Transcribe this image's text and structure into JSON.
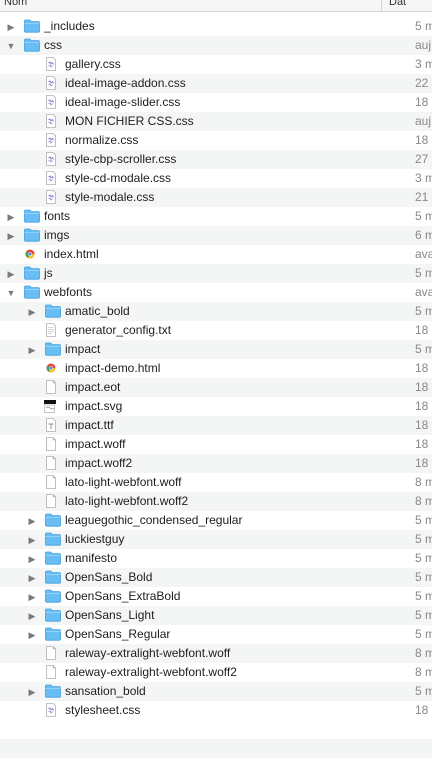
{
  "header": {
    "name_col": "Nom",
    "date_col": "Dat"
  },
  "colors": {
    "folder": "#5fb8f2",
    "stripe": "#f4f5f5"
  },
  "rows": [
    {
      "name": "_includes",
      "date": "5 m",
      "kind": "folder",
      "depth": 0,
      "disc": "collapsed"
    },
    {
      "name": "css",
      "date": "auj",
      "kind": "folder",
      "depth": 0,
      "disc": "expanded"
    },
    {
      "name": "gallery.css",
      "date": "3 m",
      "kind": "css",
      "depth": 1
    },
    {
      "name": "ideal-image-addon.css",
      "date": "22",
      "kind": "css",
      "depth": 1
    },
    {
      "name": "ideal-image-slider.css",
      "date": "18",
      "kind": "css",
      "depth": 1
    },
    {
      "name": "MON FICHIER CSS.css",
      "date": "auj",
      "kind": "css",
      "depth": 1
    },
    {
      "name": "normalize.css",
      "date": "18",
      "kind": "css",
      "depth": 1
    },
    {
      "name": "style-cbp-scroller.css",
      "date": "27",
      "kind": "css",
      "depth": 1
    },
    {
      "name": "style-cd-modale.css",
      "date": "3 m",
      "kind": "css",
      "depth": 1
    },
    {
      "name": "style-modale.css",
      "date": "21",
      "kind": "css",
      "depth": 1
    },
    {
      "name": "fonts",
      "date": "5 m",
      "kind": "folder",
      "depth": 0,
      "disc": "collapsed"
    },
    {
      "name": "imgs",
      "date": "6 m",
      "kind": "folder",
      "depth": 0,
      "disc": "collapsed"
    },
    {
      "name": "index.html",
      "date": "ava",
      "kind": "html",
      "depth": 0
    },
    {
      "name": "js",
      "date": "5 m",
      "kind": "folder",
      "depth": 0,
      "disc": "collapsed"
    },
    {
      "name": "webfonts",
      "date": "ava",
      "kind": "folder",
      "depth": 0,
      "disc": "expanded"
    },
    {
      "name": "amatic_bold",
      "date": "5 m",
      "kind": "folder",
      "depth": 1,
      "disc": "collapsed"
    },
    {
      "name": "generator_config.txt",
      "date": "18",
      "kind": "txt",
      "depth": 1
    },
    {
      "name": "impact",
      "date": "5 m",
      "kind": "folder",
      "depth": 1,
      "disc": "collapsed"
    },
    {
      "name": "impact-demo.html",
      "date": "18",
      "kind": "html",
      "depth": 1
    },
    {
      "name": "impact.eot",
      "date": "18",
      "kind": "file",
      "depth": 1
    },
    {
      "name": "impact.svg",
      "date": "18",
      "kind": "svg",
      "depth": 1
    },
    {
      "name": "impact.ttf",
      "date": "18",
      "kind": "ttf",
      "depth": 1
    },
    {
      "name": "impact.woff",
      "date": "18",
      "kind": "file",
      "depth": 1
    },
    {
      "name": "impact.woff2",
      "date": "18",
      "kind": "file",
      "depth": 1
    },
    {
      "name": "lato-light-webfont.woff",
      "date": "8 m",
      "kind": "file",
      "depth": 1
    },
    {
      "name": "lato-light-webfont.woff2",
      "date": "8 m",
      "kind": "file",
      "depth": 1
    },
    {
      "name": "leaguegothic_condensed_regular",
      "date": "5 m",
      "kind": "folder",
      "depth": 1,
      "disc": "collapsed"
    },
    {
      "name": "luckiestguy",
      "date": "5 m",
      "kind": "folder",
      "depth": 1,
      "disc": "collapsed"
    },
    {
      "name": "manifesto",
      "date": "5 m",
      "kind": "folder",
      "depth": 1,
      "disc": "collapsed"
    },
    {
      "name": "OpenSans_Bold",
      "date": "5 m",
      "kind": "folder",
      "depth": 1,
      "disc": "collapsed"
    },
    {
      "name": "OpenSans_ExtraBold",
      "date": "5 m",
      "kind": "folder",
      "depth": 1,
      "disc": "collapsed"
    },
    {
      "name": "OpenSans_Light",
      "date": "5 m",
      "kind": "folder",
      "depth": 1,
      "disc": "collapsed"
    },
    {
      "name": "OpenSans_Regular",
      "date": "5 m",
      "kind": "folder",
      "depth": 1,
      "disc": "collapsed"
    },
    {
      "name": "raleway-extralight-webfont.woff",
      "date": "8 m",
      "kind": "file",
      "depth": 1
    },
    {
      "name": "raleway-extralight-webfont.woff2",
      "date": "8 m",
      "kind": "file",
      "depth": 1
    },
    {
      "name": "sansation_bold",
      "date": "5 m",
      "kind": "folder",
      "depth": 1,
      "disc": "collapsed"
    },
    {
      "name": "stylesheet.css",
      "date": "18",
      "kind": "css",
      "depth": 1
    }
  ]
}
